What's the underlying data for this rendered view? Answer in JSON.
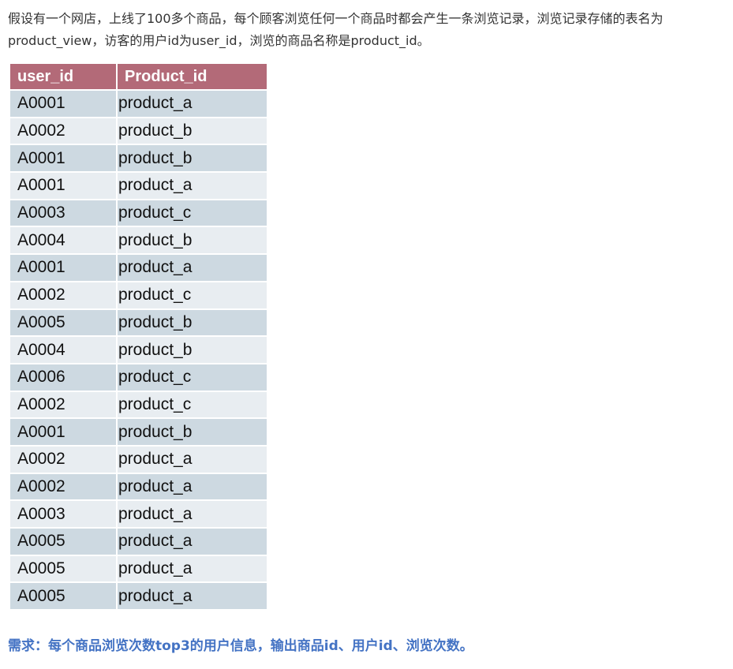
{
  "intro": "假设有一个网店，上线了100多个商品，每个顾客浏览任何一个商品时都会产生一条浏览记录，浏览记录存储的表名为product_view，访客的用户id为user_id，浏览的商品名称是product_id。",
  "table": {
    "headers": [
      "user_id",
      "Product_id"
    ],
    "rows": [
      [
        "A0001",
        "product_a"
      ],
      [
        "A0002",
        "product_b"
      ],
      [
        "A0001",
        "product_b"
      ],
      [
        "A0001",
        "product_a"
      ],
      [
        "A0003",
        "product_c"
      ],
      [
        "A0004",
        "product_b"
      ],
      [
        "A0001",
        "product_a"
      ],
      [
        "A0002",
        "product_c"
      ],
      [
        "A0005",
        "product_b"
      ],
      [
        "A0004",
        "product_b"
      ],
      [
        "A0006",
        "product_c"
      ],
      [
        "A0002",
        "product_c"
      ],
      [
        "A0001",
        "product_b"
      ],
      [
        "A0002",
        "product_a"
      ],
      [
        "A0002",
        "product_a"
      ],
      [
        "A0003",
        "product_a"
      ],
      [
        "A0005",
        "product_a"
      ],
      [
        "A0005",
        "product_a"
      ],
      [
        "A0005",
        "product_a"
      ]
    ]
  },
  "requirement": "需求：每个商品浏览次数top3的用户信息，输出商品id、用户id、浏览次数。",
  "colors": {
    "header_bg": "#b36a78",
    "row_odd": "#cdd9e1",
    "row_even": "#e8edf1",
    "requirement_text": "#4473c4"
  }
}
